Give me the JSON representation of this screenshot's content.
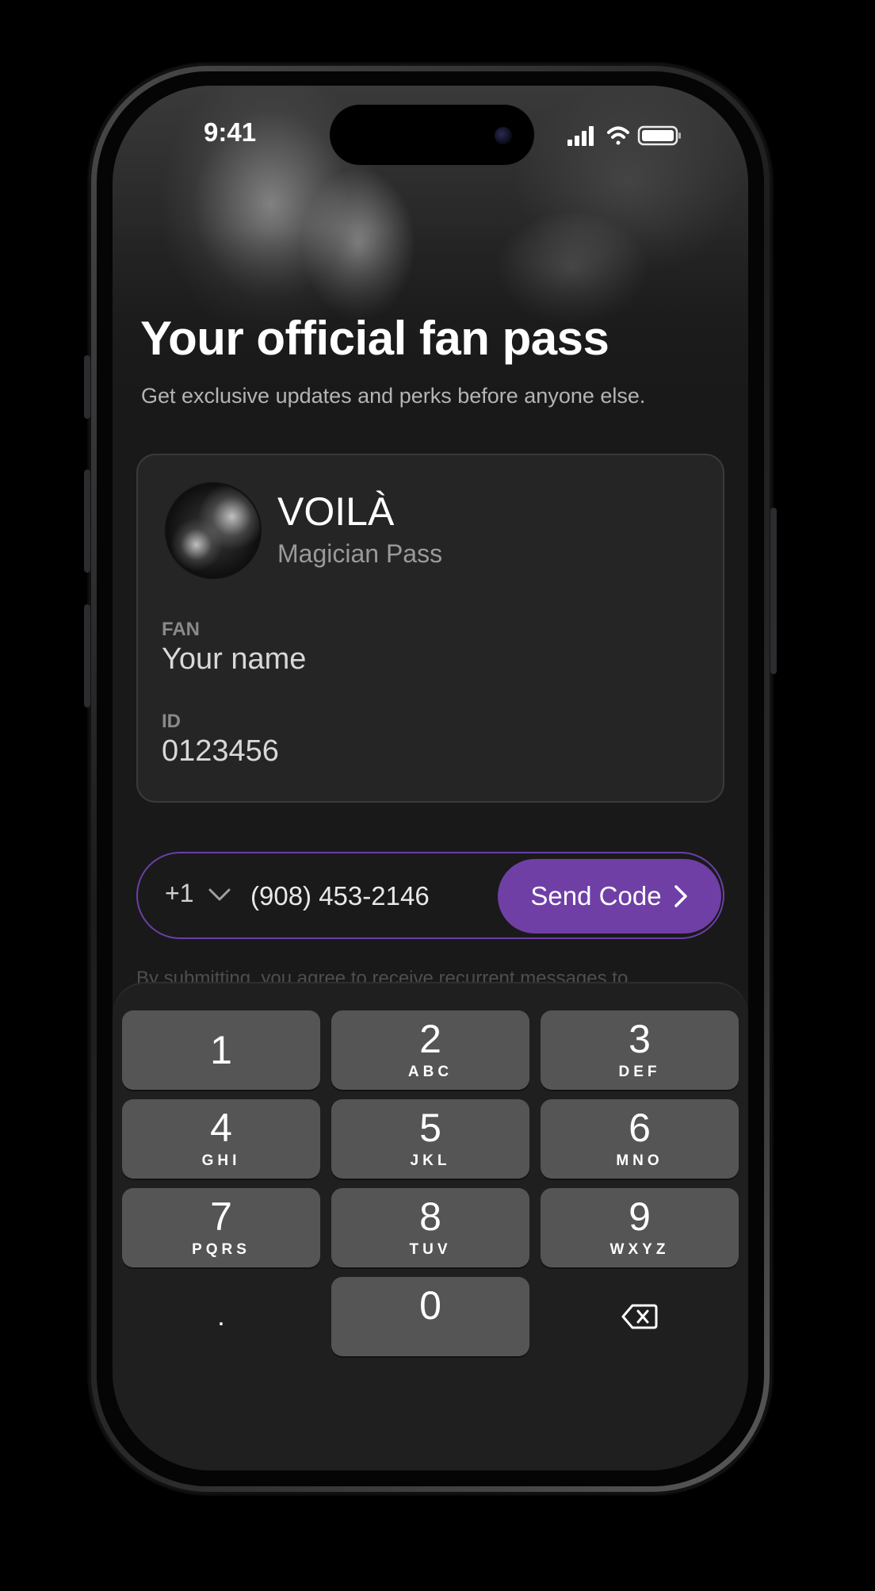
{
  "status_bar": {
    "time": "9:41",
    "icons": [
      "signal-icon",
      "wifi-icon",
      "battery-icon"
    ]
  },
  "header": {
    "title": "Your official fan pass",
    "subtitle": "Get exclusive updates and perks before anyone else."
  },
  "pass": {
    "name": "VOILÀ",
    "type": "Magician Pass",
    "fan_label": "FAN",
    "fan_value": "Your name",
    "id_label": "ID",
    "id_value": "0123456"
  },
  "phone_form": {
    "country_code": "+1",
    "phone_number": "(908) 453-2146",
    "send_label": "Send Code",
    "disclaimer": "By submitting, you agree to receive recurrent messages to"
  },
  "keypad": {
    "keys": [
      {
        "digit": "1",
        "letters": ""
      },
      {
        "digit": "2",
        "letters": "ABC"
      },
      {
        "digit": "3",
        "letters": "DEF"
      },
      {
        "digit": "4",
        "letters": "GHI"
      },
      {
        "digit": "5",
        "letters": "JKL"
      },
      {
        "digit": "6",
        "letters": "MNO"
      },
      {
        "digit": "7",
        "letters": "PQRS"
      },
      {
        "digit": "8",
        "letters": "TUV"
      },
      {
        "digit": "9",
        "letters": "WXYZ"
      },
      {
        "digit": "0",
        "letters": ""
      }
    ],
    "decimal": ".",
    "delete_icon": "backspace-icon"
  },
  "colors": {
    "accent": "#6f3fa6",
    "accent_border": "#6a3fa8",
    "background": "#191919",
    "key": "#555555"
  }
}
